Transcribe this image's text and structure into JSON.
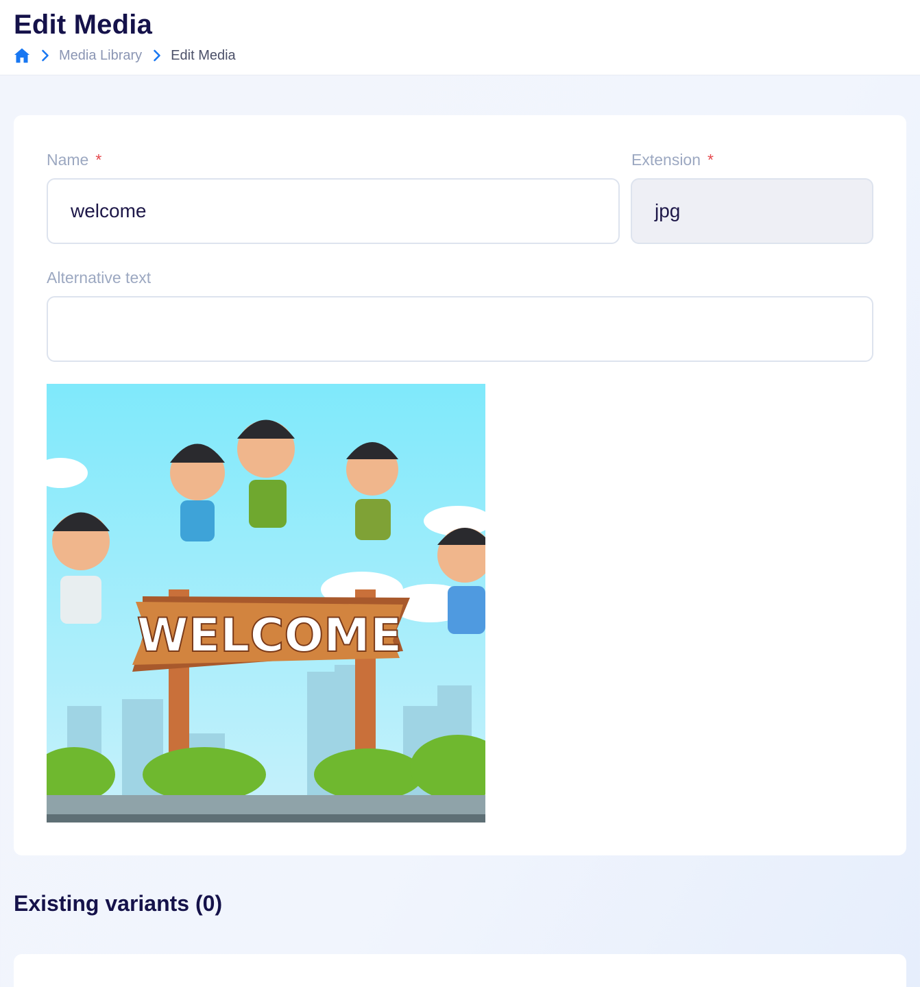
{
  "header": {
    "title": "Edit Media",
    "breadcrumb": {
      "home_icon": "home-icon",
      "separator_icon": "chevron-right-icon",
      "items": [
        {
          "label": "Media Library"
        },
        {
          "label": "Edit Media"
        }
      ]
    }
  },
  "form": {
    "name": {
      "label": "Name",
      "required_mark": "*",
      "value": "welcome"
    },
    "extension": {
      "label": "Extension",
      "required_mark": "*",
      "value": "jpg"
    },
    "alt_text": {
      "label": "Alternative text",
      "value": ""
    },
    "preview": {
      "sign_text": "WELCOME"
    }
  },
  "variants": {
    "title": "Existing variants (0)"
  },
  "colors": {
    "accent": "#1877f2",
    "heading": "#15124a",
    "required": "#e5484d",
    "label": "#9ca8c1"
  }
}
